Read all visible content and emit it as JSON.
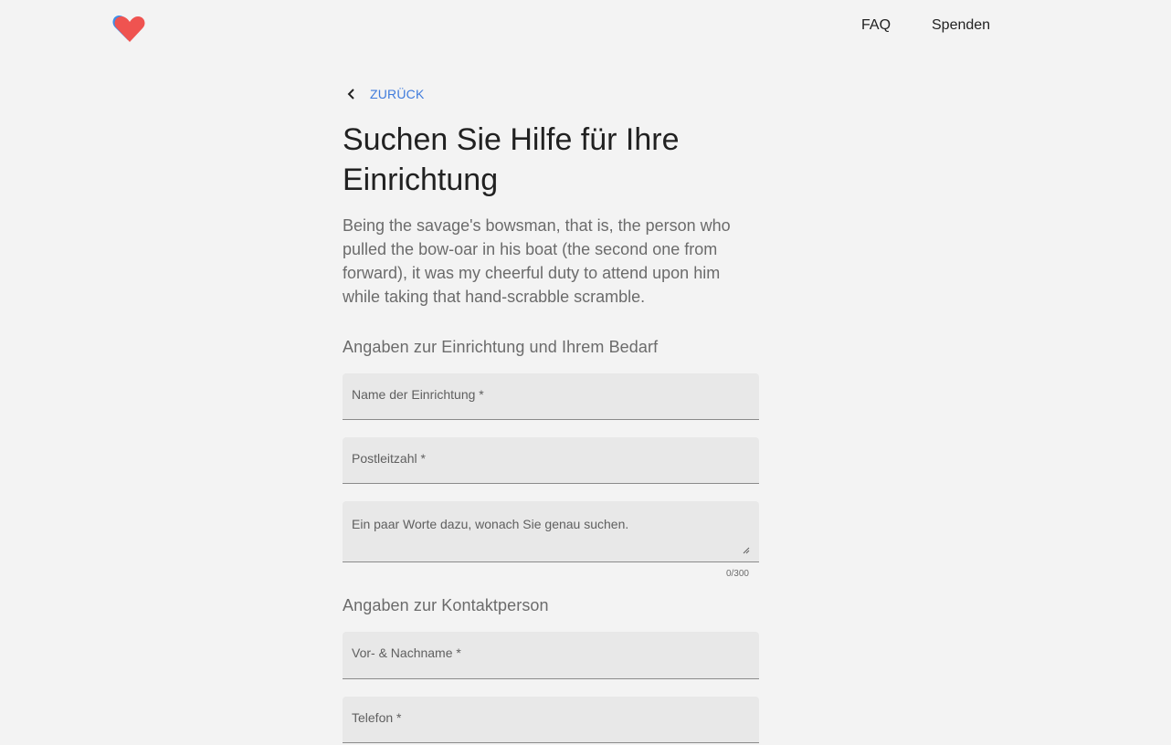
{
  "brand": {
    "logo_icon": "heart-icon",
    "colors": {
      "heart_blue": "#3d8ee8",
      "heart_red": "#ef5350",
      "link": "#3f7bdc"
    }
  },
  "header": {
    "nav": [
      {
        "label": "FAQ"
      },
      {
        "label": "Spenden"
      }
    ]
  },
  "main": {
    "back_label": "ZURÜCK",
    "back_icon": "chevron-left-icon",
    "title": "Suchen Sie Hilfe für Ihre Einrichtung",
    "intro": "Being the savage's bowsman, that is, the person who pulled the bow-oar in his boat (the second one from forward), it was my cheerful duty to attend upon him while taking that hand-scrabble scramble.",
    "section_facility": {
      "title": "Angaben zur Einrichtung und Ihrem Bedarf",
      "fields": {
        "name": {
          "placeholder": "Name der Einrichtung *",
          "value": ""
        },
        "postcode": {
          "placeholder": "Postleitzahl *",
          "value": ""
        },
        "description": {
          "placeholder": "Ein paar Worte dazu, wonach Sie genau suchen.",
          "value": "",
          "counter": "0/300"
        }
      }
    },
    "section_contact": {
      "title": "Angaben zur Kontaktperson",
      "fields": {
        "fullname": {
          "placeholder": "Vor- & Nachname *",
          "value": ""
        },
        "phone": {
          "placeholder": "Telefon *",
          "value": ""
        }
      }
    }
  }
}
